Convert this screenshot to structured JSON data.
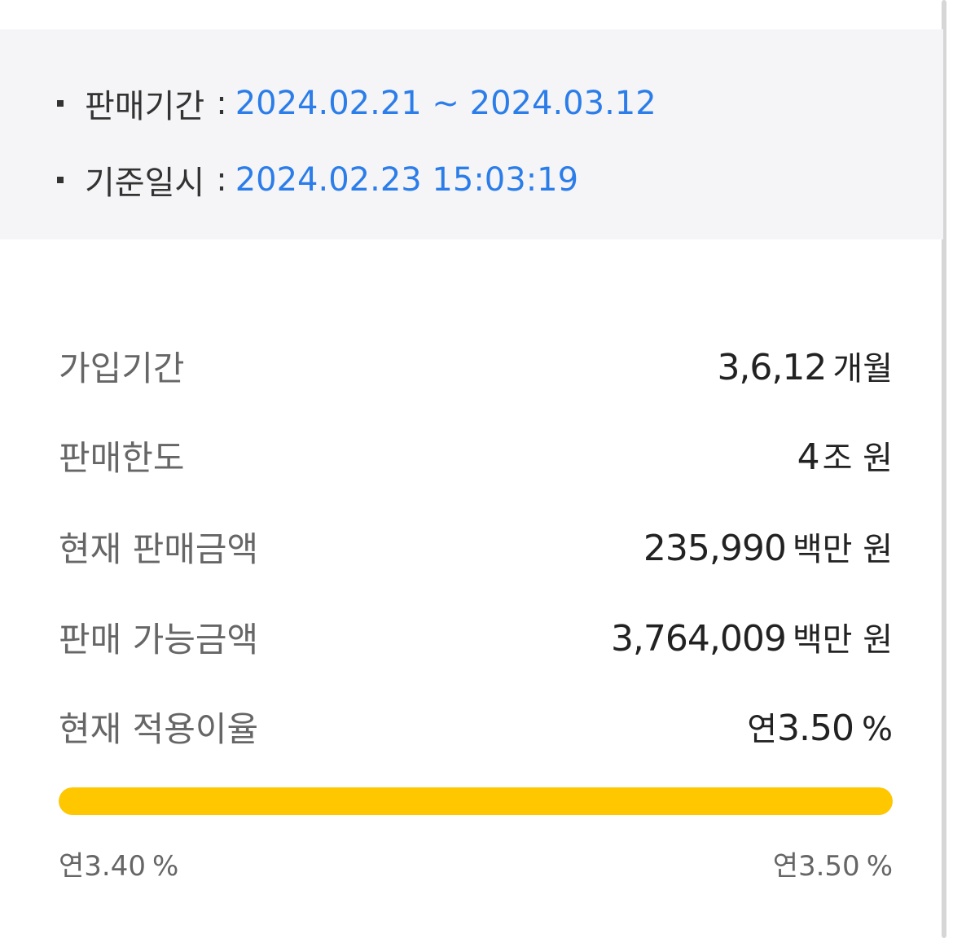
{
  "sale_info": {
    "period": {
      "label": "판매기간",
      "colon": ":",
      "value": "2024.02.21 ~ 2024.03.12"
    },
    "base_time": {
      "label": "기준일시",
      "colon": ":",
      "value": "2024.02.23 15:03:19"
    }
  },
  "details": {
    "join_period": {
      "label": "가입기간",
      "value": "3,6,12",
      "unit": "개월"
    },
    "sale_limit": {
      "label": "판매한도",
      "value": "4",
      "unit": "조 원"
    },
    "current_sales": {
      "label": "현재 판매금액",
      "value": "235,990",
      "unit": "백만 원"
    },
    "available_sales": {
      "label": "판매 가능금액",
      "value": "3,764,009",
      "unit": "백만 원"
    },
    "current_rate": {
      "label": "현재 적용이율",
      "prefix": "연",
      "value": "3.50",
      "unit": "%"
    }
  },
  "rate_bar": {
    "progress_fraction": 1.0,
    "fill_color": "#FEC700",
    "track_color": "#E8E8EA",
    "min": {
      "prefix": "연",
      "value": "3.40",
      "unit": "%"
    },
    "max": {
      "prefix": "연",
      "value": "3.50",
      "unit": "%"
    }
  }
}
